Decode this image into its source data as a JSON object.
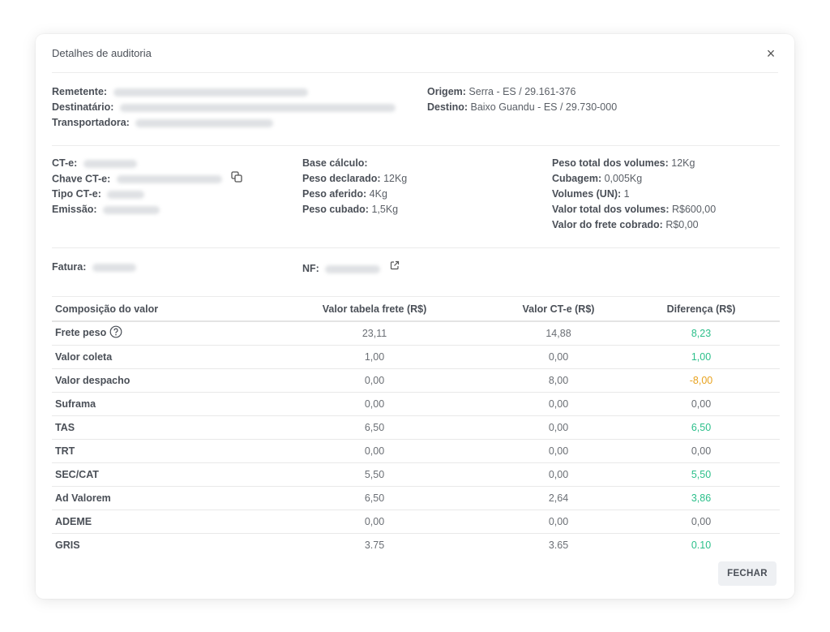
{
  "modal": {
    "title": "Detalhes de auditoria",
    "close_label": "×",
    "close_button_label": "FECHAR"
  },
  "parties": {
    "remetente_label": "Remetente:",
    "destinatario_label": "Destinatário:",
    "transportadora_label": "Transportadora:",
    "origem_label": "Origem:",
    "origem_value": "Serra - ES / 29.161-376",
    "destino_label": "Destino:",
    "destino_value": "Baixo Guandu - ES / 29.730-000"
  },
  "cte": {
    "cte_label": "CT-e:",
    "chave_label": "Chave CT-e:",
    "tipo_label": "Tipo CT-e:",
    "emissao_label": "Emissão:"
  },
  "weights": {
    "base_calculo_label": "Base cálculo:",
    "peso_declarado_label": "Peso declarado:",
    "peso_declarado_value": "12Kg",
    "peso_aferido_label": "Peso aferido:",
    "peso_aferido_value": "4Kg",
    "peso_cubado_label": "Peso cubado:",
    "peso_cubado_value": "1,5Kg"
  },
  "volumes": {
    "peso_total_label": "Peso total dos volumes:",
    "peso_total_value": "12Kg",
    "cubagem_label": "Cubagem:",
    "cubagem_value": "0,005Kg",
    "volumes_label": "Volumes (UN):",
    "volumes_value": "1",
    "valor_total_label": "Valor total dos volumes:",
    "valor_total_value": "R$600,00",
    "valor_frete_label": "Valor do frete cobrado:",
    "valor_frete_value": "R$0,00"
  },
  "invoice": {
    "fatura_label": "Fatura:",
    "nf_label": "NF:"
  },
  "table": {
    "headers": [
      "Composição do valor",
      "Valor tabela frete (R$)",
      "Valor CT-e (R$)",
      "Diferença (R$)"
    ],
    "rows": [
      {
        "name": "Frete peso",
        "tabela": "23,11",
        "cte": "14,88",
        "diff": "8,23",
        "status": "pos"
      },
      {
        "name": "Valor coleta",
        "tabela": "1,00",
        "cte": "0,00",
        "diff": "1,00",
        "status": "pos"
      },
      {
        "name": "Valor despacho",
        "tabela": "0,00",
        "cte": "8,00",
        "diff": "-8,00",
        "status": "neg"
      },
      {
        "name": "Suframa",
        "tabela": "0,00",
        "cte": "0,00",
        "diff": "0,00",
        "status": "zero"
      },
      {
        "name": "TAS",
        "tabela": "6,50",
        "cte": "0,00",
        "diff": "6,50",
        "status": "pos"
      },
      {
        "name": "TRT",
        "tabela": "0,00",
        "cte": "0,00",
        "diff": "0,00",
        "status": "zero"
      },
      {
        "name": "SEC/CAT",
        "tabela": "5,50",
        "cte": "0,00",
        "diff": "5,50",
        "status": "pos"
      },
      {
        "name": "Ad Valorem",
        "tabela": "6,50",
        "cte": "2,64",
        "diff": "3,86",
        "status": "pos"
      },
      {
        "name": "ADEME",
        "tabela": "0,00",
        "cte": "0,00",
        "diff": "0,00",
        "status": "zero"
      },
      {
        "name": "GRIS",
        "tabela": "3,75",
        "cte": "3,65",
        "diff": "0,10",
        "status": "pos"
      }
    ]
  },
  "colors": {
    "positive": "#2bbf8a",
    "negative": "#e8a21e"
  }
}
